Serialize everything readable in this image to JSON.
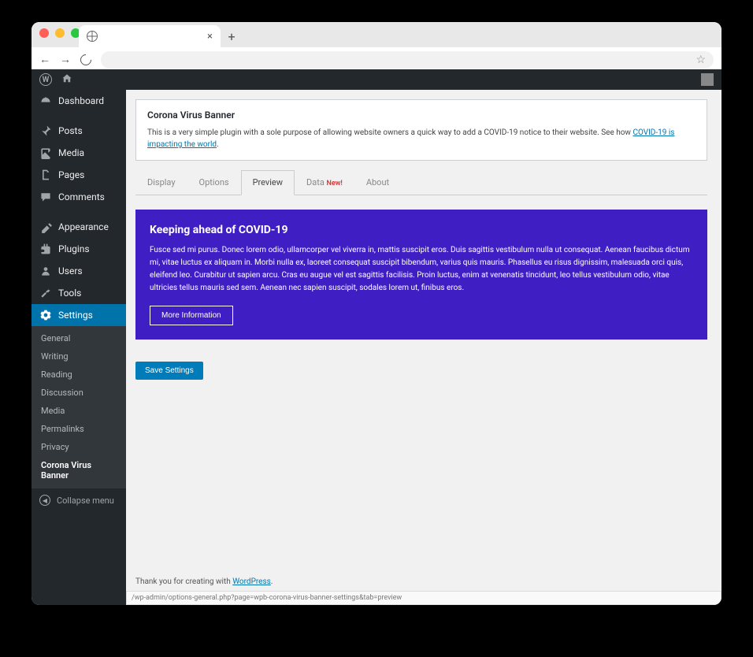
{
  "sidebar": {
    "items": [
      {
        "label": "Dashboard",
        "icon": "dashboard"
      },
      {
        "label": "Posts",
        "icon": "pin"
      },
      {
        "label": "Media",
        "icon": "media"
      },
      {
        "label": "Pages",
        "icon": "pages"
      },
      {
        "label": "Comments",
        "icon": "comments"
      },
      {
        "label": "Appearance",
        "icon": "appearance"
      },
      {
        "label": "Plugins",
        "icon": "plugins"
      },
      {
        "label": "Users",
        "icon": "users"
      },
      {
        "label": "Tools",
        "icon": "tools"
      },
      {
        "label": "Settings",
        "icon": "settings"
      }
    ],
    "submenu": [
      "General",
      "Writing",
      "Reading",
      "Discussion",
      "Media",
      "Permalinks",
      "Privacy",
      "Corona Virus Banner"
    ],
    "collapse": "Collapse menu"
  },
  "intro": {
    "title": "Corona Virus Banner",
    "desc": "This is a very simple plugin with a sole purpose of allowing website owners a quick way to add a COVID-19 notice to their website. See how ",
    "link": "COVID-19 is impacting the world"
  },
  "tabs": {
    "items": [
      "Display",
      "Options",
      "Preview",
      "Data",
      "About"
    ],
    "badge": "New!",
    "active": "Preview"
  },
  "banner": {
    "heading": "Keeping ahead of COVID-19",
    "body": "Fusce sed mi purus. Donec lorem odio, ullamcorper vel viverra in, mattis suscipit eros. Duis sagittis vestibulum nulla ut consequat. Aenean faucibus dictum mi, vitae luctus ex aliquam in. Morbi nulla ex, laoreet consequat suscipit bibendum, varius quis mauris. Phasellus eu risus dignissim, malesuada orci quis, eleifend leo. Curabitur ut sapien arcu. Cras eu augue vel est sagittis facilisis. Proin luctus, enim at venenatis tincidunt, leo tellus vestibulum odio, vitae ultricies tellus mauris sed sem. Aenean nec sapien suscipit, sodales lorem ut, finibus eros.",
    "button": "More Information"
  },
  "save": "Save Settings",
  "footer": {
    "pre": "Thank you for creating with ",
    "link": "WordPress"
  },
  "statusbar": "/wp-admin/options-general.php?page=wpb-corona-virus-banner-settings&tab=preview"
}
